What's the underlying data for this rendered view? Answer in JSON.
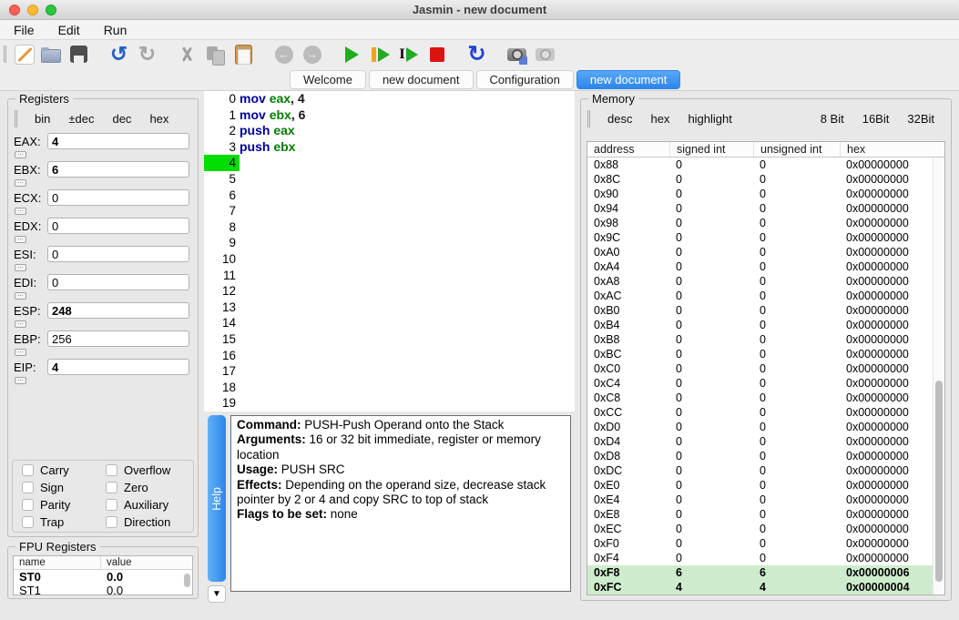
{
  "window": {
    "title": "Jasmin - new document"
  },
  "menu": {
    "items": [
      "File",
      "Edit",
      "Run"
    ]
  },
  "toolbar": {
    "icons": [
      {
        "name": "new-file-icon",
        "enabled": true
      },
      {
        "name": "open-file-icon",
        "enabled": true
      },
      {
        "name": "save-file-icon",
        "enabled": true
      },
      {
        "name": "undo-icon",
        "enabled": true
      },
      {
        "name": "redo-icon",
        "enabled": false
      },
      {
        "name": "cut-icon",
        "enabled": false
      },
      {
        "name": "copy-icon",
        "enabled": false
      },
      {
        "name": "paste-icon",
        "enabled": true
      },
      {
        "name": "back-icon",
        "enabled": false
      },
      {
        "name": "forward-icon",
        "enabled": false
      },
      {
        "name": "run-icon",
        "enabled": true
      },
      {
        "name": "run-pause-icon",
        "enabled": true
      },
      {
        "name": "step-icon",
        "enabled": true
      },
      {
        "name": "stop-icon",
        "enabled": true
      },
      {
        "name": "reset-icon",
        "enabled": true
      },
      {
        "name": "snapshot-save-icon",
        "enabled": true
      },
      {
        "name": "snapshot-load-icon",
        "enabled": false
      }
    ]
  },
  "tabs": [
    {
      "label": "Welcome",
      "active": false
    },
    {
      "label": "new document",
      "active": false
    },
    {
      "label": "Configuration",
      "active": false
    },
    {
      "label": "new document",
      "active": true
    }
  ],
  "registers": {
    "title": "Registers",
    "format_buttons": [
      "bin",
      "±dec",
      "dec",
      "hex"
    ],
    "rows": [
      {
        "name": "EAX:",
        "value": "4",
        "changed": true
      },
      {
        "name": "EBX:",
        "value": "6",
        "changed": true
      },
      {
        "name": "ECX:",
        "value": "0",
        "changed": false
      },
      {
        "name": "EDX:",
        "value": "0",
        "changed": false
      },
      {
        "name": "ESI:",
        "value": "0",
        "changed": false
      },
      {
        "name": "EDI:",
        "value": "0",
        "changed": false
      },
      {
        "name": "ESP:",
        "value": "248",
        "changed": true
      },
      {
        "name": "EBP:",
        "value": "256",
        "changed": false
      },
      {
        "name": "EIP:",
        "value": "4",
        "changed": true
      }
    ],
    "flags": [
      {
        "label": "Carry",
        "checked": false
      },
      {
        "label": "Overflow",
        "checked": false
      },
      {
        "label": "Sign",
        "checked": false
      },
      {
        "label": "Zero",
        "checked": false
      },
      {
        "label": "Parity",
        "checked": false
      },
      {
        "label": "Auxiliary",
        "checked": false
      },
      {
        "label": "Trap",
        "checked": false
      },
      {
        "label": "Direction",
        "checked": false
      }
    ]
  },
  "fpu": {
    "title": "FPU Registers",
    "columns": [
      "name",
      "value"
    ],
    "rows": [
      {
        "name": "ST0",
        "value": "0.0",
        "bold": true
      },
      {
        "name": "ST1",
        "value": "0.0",
        "bold": false
      }
    ]
  },
  "editor": {
    "visible_lines": 20,
    "current_line": 4,
    "lines": [
      {
        "n": 0,
        "tokens": [
          [
            "kw",
            "mov"
          ],
          [
            "pl",
            " "
          ],
          [
            "reg",
            "eax"
          ],
          [
            "pl",
            ", 4"
          ]
        ]
      },
      {
        "n": 1,
        "tokens": [
          [
            "kw",
            "mov"
          ],
          [
            "pl",
            " "
          ],
          [
            "reg",
            "ebx"
          ],
          [
            "pl",
            ", 6"
          ]
        ]
      },
      {
        "n": 2,
        "tokens": [
          [
            "kw",
            "push"
          ],
          [
            "pl",
            " "
          ],
          [
            "reg",
            "eax"
          ]
        ]
      },
      {
        "n": 3,
        "tokens": [
          [
            "kw",
            "push"
          ],
          [
            "pl",
            " "
          ],
          [
            "reg",
            "ebx"
          ]
        ]
      }
    ]
  },
  "help": {
    "tab_label": "Help",
    "collapse_icon": "▼",
    "entries": [
      {
        "label": "Command:",
        "text": " PUSH-Push Operand onto the Stack"
      },
      {
        "label": "Arguments:",
        "text": " 16 or 32 bit immediate, register or memory location"
      },
      {
        "label": "Usage:",
        "text": " PUSH SRC"
      },
      {
        "label": "Effects:",
        "text": " Depending on the operand size, decrease stack pointer by 2 or 4 and copy SRC to top of stack"
      },
      {
        "label": "Flags to be set:",
        "text": " none"
      }
    ]
  },
  "memory": {
    "title": "Memory",
    "format_buttons": [
      "desc",
      "hex",
      "highlight"
    ],
    "width_buttons": [
      "8 Bit",
      "16Bit",
      "32Bit"
    ],
    "columns": [
      "address",
      "signed int",
      "unsigned int",
      "hex"
    ],
    "rows": [
      {
        "address": "0x88",
        "signed": "0",
        "unsigned": "0",
        "hex": "0x00000000",
        "highlight": false
      },
      {
        "address": "0x8C",
        "signed": "0",
        "unsigned": "0",
        "hex": "0x00000000",
        "highlight": false
      },
      {
        "address": "0x90",
        "signed": "0",
        "unsigned": "0",
        "hex": "0x00000000",
        "highlight": false
      },
      {
        "address": "0x94",
        "signed": "0",
        "unsigned": "0",
        "hex": "0x00000000",
        "highlight": false
      },
      {
        "address": "0x98",
        "signed": "0",
        "unsigned": "0",
        "hex": "0x00000000",
        "highlight": false
      },
      {
        "address": "0x9C",
        "signed": "0",
        "unsigned": "0",
        "hex": "0x00000000",
        "highlight": false
      },
      {
        "address": "0xA0",
        "signed": "0",
        "unsigned": "0",
        "hex": "0x00000000",
        "highlight": false
      },
      {
        "address": "0xA4",
        "signed": "0",
        "unsigned": "0",
        "hex": "0x00000000",
        "highlight": false
      },
      {
        "address": "0xA8",
        "signed": "0",
        "unsigned": "0",
        "hex": "0x00000000",
        "highlight": false
      },
      {
        "address": "0xAC",
        "signed": "0",
        "unsigned": "0",
        "hex": "0x00000000",
        "highlight": false
      },
      {
        "address": "0xB0",
        "signed": "0",
        "unsigned": "0",
        "hex": "0x00000000",
        "highlight": false
      },
      {
        "address": "0xB4",
        "signed": "0",
        "unsigned": "0",
        "hex": "0x00000000",
        "highlight": false
      },
      {
        "address": "0xB8",
        "signed": "0",
        "unsigned": "0",
        "hex": "0x00000000",
        "highlight": false
      },
      {
        "address": "0xBC",
        "signed": "0",
        "unsigned": "0",
        "hex": "0x00000000",
        "highlight": false
      },
      {
        "address": "0xC0",
        "signed": "0",
        "unsigned": "0",
        "hex": "0x00000000",
        "highlight": false
      },
      {
        "address": "0xC4",
        "signed": "0",
        "unsigned": "0",
        "hex": "0x00000000",
        "highlight": false
      },
      {
        "address": "0xC8",
        "signed": "0",
        "unsigned": "0",
        "hex": "0x00000000",
        "highlight": false
      },
      {
        "address": "0xCC",
        "signed": "0",
        "unsigned": "0",
        "hex": "0x00000000",
        "highlight": false
      },
      {
        "address": "0xD0",
        "signed": "0",
        "unsigned": "0",
        "hex": "0x00000000",
        "highlight": false
      },
      {
        "address": "0xD4",
        "signed": "0",
        "unsigned": "0",
        "hex": "0x00000000",
        "highlight": false
      },
      {
        "address": "0xD8",
        "signed": "0",
        "unsigned": "0",
        "hex": "0x00000000",
        "highlight": false
      },
      {
        "address": "0xDC",
        "signed": "0",
        "unsigned": "0",
        "hex": "0x00000000",
        "highlight": false
      },
      {
        "address": "0xE0",
        "signed": "0",
        "unsigned": "0",
        "hex": "0x00000000",
        "highlight": false
      },
      {
        "address": "0xE4",
        "signed": "0",
        "unsigned": "0",
        "hex": "0x00000000",
        "highlight": false
      },
      {
        "address": "0xE8",
        "signed": "0",
        "unsigned": "0",
        "hex": "0x00000000",
        "highlight": false
      },
      {
        "address": "0xEC",
        "signed": "0",
        "unsigned": "0",
        "hex": "0x00000000",
        "highlight": false
      },
      {
        "address": "0xF0",
        "signed": "0",
        "unsigned": "0",
        "hex": "0x00000000",
        "highlight": false
      },
      {
        "address": "0xF4",
        "signed": "0",
        "unsigned": "0",
        "hex": "0x00000000",
        "highlight": false
      },
      {
        "address": "0xF8",
        "signed": "6",
        "unsigned": "6",
        "hex": "0x00000006",
        "highlight": true
      },
      {
        "address": "0xFC",
        "signed": "4",
        "unsigned": "4",
        "hex": "0x00000004",
        "highlight": true
      }
    ]
  },
  "colors": {
    "accent_blue": "#3e96ee",
    "exec_line_green": "#00dd00",
    "memory_highlight_green": "#cdeccd",
    "keyword_blue": "#000099",
    "register_green": "#007d00",
    "help_tab_blue": "#3d94f0",
    "run_green": "#1fae1f",
    "stop_red": "#da1510"
  }
}
